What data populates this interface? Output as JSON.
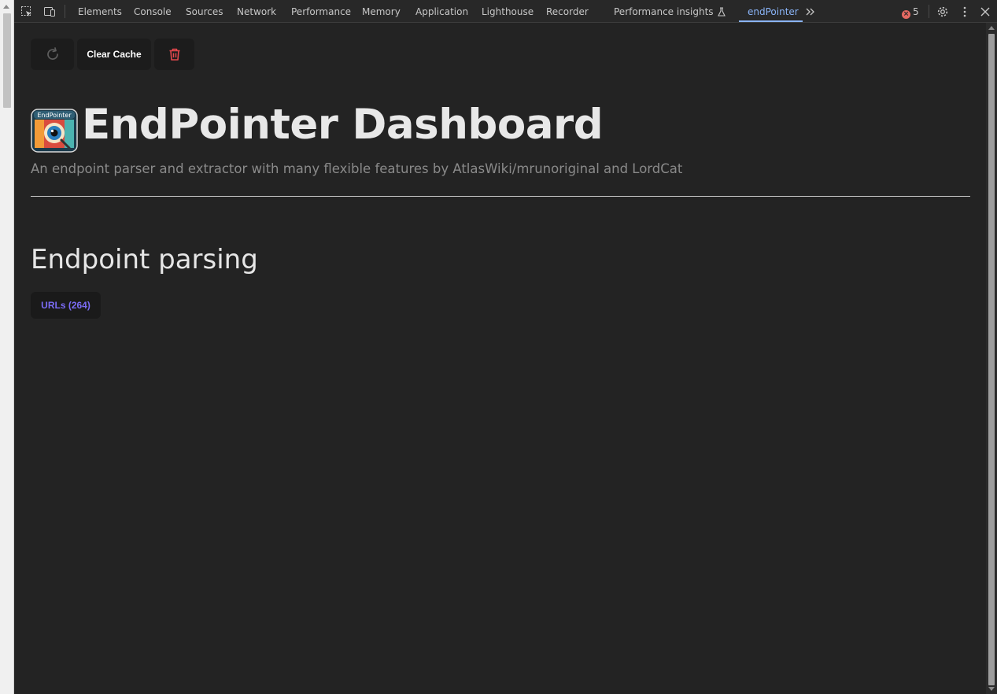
{
  "devtools": {
    "tabs": [
      {
        "label": "Elements"
      },
      {
        "label": "Console"
      },
      {
        "label": "Sources"
      },
      {
        "label": "Network"
      },
      {
        "label": "Performance"
      },
      {
        "label": "Memory"
      },
      {
        "label": "Application"
      },
      {
        "label": "Lighthouse"
      },
      {
        "label": "Recorder"
      },
      {
        "label": "Performance insights"
      },
      {
        "label": "endPointer"
      }
    ],
    "active_tab": "endPointer",
    "error_count": "5",
    "accent_color": "#8ab4f8"
  },
  "toolbar": {
    "clear_cache_label": "Clear Cache"
  },
  "header": {
    "logo_text": "EndPointer",
    "title": "EndPointer Dashboard",
    "subtitle": "An endpoint parser and extractor with many flexible features by AtlasWiki/mrunoriginal and LordCat"
  },
  "section": {
    "title": "Endpoint parsing",
    "urls_button": "URLs (264)"
  },
  "colors": {
    "background": "#232323",
    "trash_icon": "#e5484d",
    "urls_text": "#7b6cf6"
  }
}
